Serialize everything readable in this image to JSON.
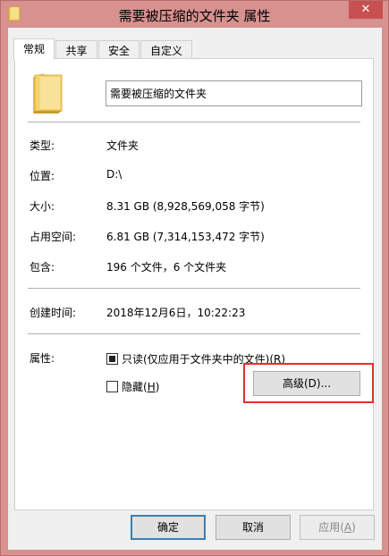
{
  "window": {
    "title": "需要被压缩的文件夹 属性",
    "close_glyph": "✕"
  },
  "tabs": [
    {
      "label": "常规",
      "active": true
    },
    {
      "label": "共享",
      "active": false
    },
    {
      "label": "安全",
      "active": false
    },
    {
      "label": "自定义",
      "active": false
    }
  ],
  "general": {
    "folder_name": "需要被压缩的文件夹",
    "rows": {
      "type": {
        "label": "类型:",
        "value": "文件夹"
      },
      "location": {
        "label": "位置:",
        "value": "D:\\"
      },
      "size": {
        "label": "大小:",
        "value": "8.31 GB (8,928,569,058 字节)"
      },
      "size_on_disk": {
        "label": "占用空间:",
        "value": "6.81 GB (7,314,153,472 字节)"
      },
      "contains": {
        "label": "包含:",
        "value": "196 个文件，6 个文件夹"
      },
      "created": {
        "label": "创建时间:",
        "value": "2018年12月6日，10:22:23"
      }
    },
    "attributes": {
      "label": "属性:",
      "readonly": {
        "label": "只读(仅应用于文件夹中的文件)(",
        "key": "R",
        "suffix": ")",
        "state": "indeterminate"
      },
      "hidden": {
        "label": "隐藏(",
        "key": "H",
        "suffix": ")",
        "checked": false
      },
      "advanced_button": "高级(D)..."
    }
  },
  "footer": {
    "ok": "确定",
    "cancel": "取消",
    "apply_prefix": "应用(",
    "apply_key": "A",
    "apply_suffix": ")"
  },
  "colors": {
    "highlight": "#e03030",
    "titlebar": "#d7918f",
    "close_button": "#c75050"
  }
}
